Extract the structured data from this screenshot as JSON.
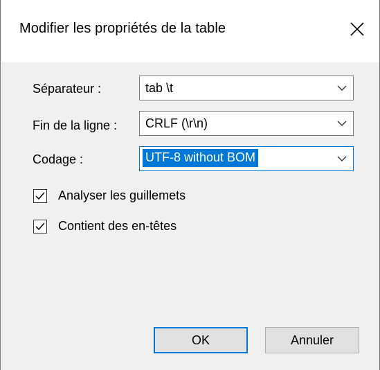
{
  "dialog": {
    "title": "Modifier les propriétés de la table",
    "close_icon": "close-icon"
  },
  "fields": {
    "separator": {
      "label": "Séparateur :",
      "value": "tab \\t"
    },
    "line_ending": {
      "label": "Fin de la ligne :",
      "value": "CRLF (\\r\\n)"
    },
    "encoding": {
      "label": "Codage :",
      "value": "UTF-8 without BOM"
    }
  },
  "options": {
    "parse_quotes": {
      "label": "Analyser les guillemets",
      "checked": true
    },
    "has_headers": {
      "label": "Contient des en-têtes",
      "checked": true
    }
  },
  "buttons": {
    "ok_label": "OK",
    "cancel_label": "Annuler"
  },
  "colors": {
    "accent": "#0078d7",
    "client_background": "#f0f0f0",
    "button_face": "#e1e1e1"
  }
}
